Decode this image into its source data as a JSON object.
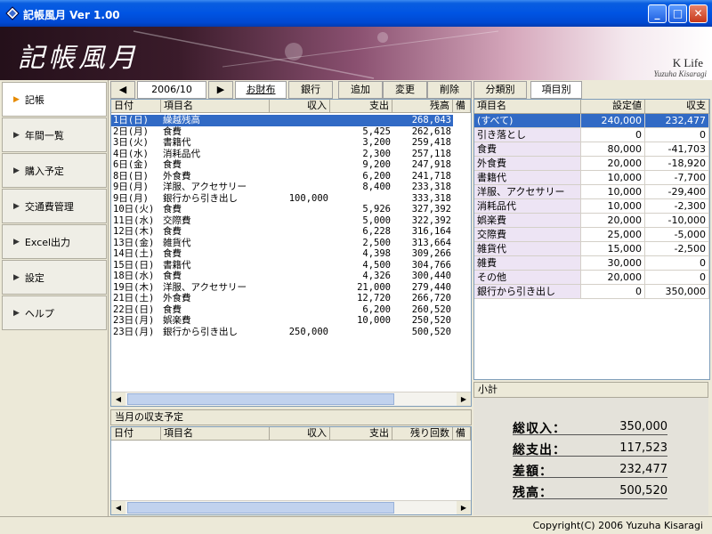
{
  "window": {
    "title": "記帳風月 Ver 1.00",
    "min": "_",
    "max": "□",
    "close": "✕"
  },
  "banner": {
    "logo": "記帳風月",
    "brand": "K Life",
    "author": "Yuzuha Kisaragi"
  },
  "sidebar": {
    "items": [
      {
        "label": "記帳",
        "active": true
      },
      {
        "label": "年間一覧"
      },
      {
        "label": "購入予定"
      },
      {
        "label": "交通費管理"
      },
      {
        "label": "Excel出力"
      },
      {
        "label": "設定"
      },
      {
        "label": "ヘルプ"
      }
    ]
  },
  "toolbar": {
    "prev": "◀",
    "month": "2006/10",
    "next": "▶",
    "wallet": "お財布",
    "bank": "銀行",
    "add": "追加",
    "change": "変更",
    "delete": "削除"
  },
  "tabs": {
    "category": "分類別",
    "item": "項目別"
  },
  "ledger": {
    "columns": [
      "日付",
      "項目名",
      "収入",
      "支出",
      "残高",
      "備"
    ],
    "rows": [
      [
        "1日(日)",
        "繰越残高",
        "",
        "",
        "268,043"
      ],
      [
        "2日(月)",
        "食費",
        "",
        "5,425",
        "262,618"
      ],
      [
        "3日(火)",
        "書籍代",
        "",
        "3,200",
        "259,418"
      ],
      [
        "4日(水)",
        "消耗品代",
        "",
        "2,300",
        "257,118"
      ],
      [
        "6日(金)",
        "食費",
        "",
        "9,200",
        "247,918"
      ],
      [
        "8日(日)",
        "外食費",
        "",
        "6,200",
        "241,718"
      ],
      [
        "9日(月)",
        "洋服、アクセサリー",
        "",
        "8,400",
        "233,318"
      ],
      [
        "9日(月)",
        "銀行から引き出し",
        "100,000",
        "",
        "333,318"
      ],
      [
        "10日(火)",
        "食費",
        "",
        "5,926",
        "327,392"
      ],
      [
        "11日(水)",
        "交際費",
        "",
        "5,000",
        "322,392"
      ],
      [
        "12日(木)",
        "食費",
        "",
        "6,228",
        "316,164"
      ],
      [
        "13日(金)",
        "雑貨代",
        "",
        "2,500",
        "313,664"
      ],
      [
        "14日(土)",
        "食費",
        "",
        "4,398",
        "309,266"
      ],
      [
        "15日(日)",
        "書籍代",
        "",
        "4,500",
        "304,766"
      ],
      [
        "18日(水)",
        "食費",
        "",
        "4,326",
        "300,440"
      ],
      [
        "19日(木)",
        "洋服、アクセサリー",
        "",
        "21,000",
        "279,440"
      ],
      [
        "21日(土)",
        "外食費",
        "",
        "12,720",
        "266,720"
      ],
      [
        "22日(日)",
        "食費",
        "",
        "6,200",
        "260,520"
      ],
      [
        "23日(月)",
        "娯楽費",
        "",
        "10,000",
        "250,520"
      ],
      [
        "23日(月)",
        "銀行から引き出し",
        "250,000",
        "",
        "500,520"
      ]
    ]
  },
  "plan": {
    "title": "当月の収支予定",
    "columns": [
      "日付",
      "項目名",
      "収入",
      "支出",
      "残り回数",
      "備"
    ]
  },
  "categories": {
    "columns": [
      "項目名",
      "設定値",
      "収支"
    ],
    "rows": [
      [
        "(すべて)",
        "240,000",
        "232,477"
      ],
      [
        "引き落とし",
        "0",
        "0"
      ],
      [
        "食費",
        "80,000",
        "-41,703"
      ],
      [
        "外食費",
        "20,000",
        "-18,920"
      ],
      [
        "書籍代",
        "10,000",
        "-7,700"
      ],
      [
        "洋服、アクセサリー",
        "10,000",
        "-29,400"
      ],
      [
        "消耗品代",
        "10,000",
        "-2,300"
      ],
      [
        "娯楽費",
        "20,000",
        "-10,000"
      ],
      [
        "交際費",
        "25,000",
        "-5,000"
      ],
      [
        "雑貨代",
        "15,000",
        "-2,500"
      ],
      [
        "雑費",
        "30,000",
        "0"
      ],
      [
        "その他",
        "20,000",
        "0"
      ],
      [
        "銀行から引き出し",
        "0",
        "350,000"
      ]
    ]
  },
  "summary": {
    "title": "小計",
    "total_income_label": "総収入：",
    "total_income": "350,000",
    "total_expense_label": "総支出：",
    "total_expense": "117,523",
    "difference_label": "差額：",
    "difference": "232,477",
    "balance_label": "残高：",
    "balance": "500,520"
  },
  "status": {
    "copyright": "Copyright(C) 2006 Yuzuha Kisaragi"
  }
}
